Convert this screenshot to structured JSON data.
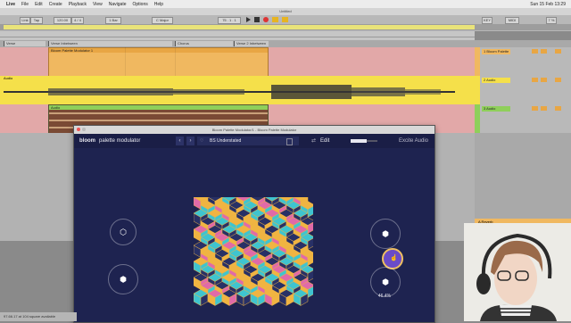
{
  "menubar": {
    "items": [
      "Live",
      "File",
      "Edit",
      "Create",
      "Playback",
      "View",
      "Navigate",
      "Options",
      "Help"
    ],
    "clock": "Sun 15 Feb 13:29"
  },
  "transport": {
    "tempo": "120.00",
    "signature": "4 / 4",
    "quantize": "1 Bar",
    "key": "C Major",
    "position": "75 . 1 . 1",
    "window_title": "Untitled",
    "cpu": "7 %",
    "midi": "MIDI",
    "key_btn": "KEY"
  },
  "arrangement": {
    "locators": [
      "Verse",
      "Verse Inbetween",
      "Chorus",
      "Verse 2 Inbetween"
    ],
    "tracks": [
      {
        "name": "Bloom Palette Modulator 1",
        "color": "#f0b860"
      },
      {
        "name": "Audio",
        "color": "#f5e04a"
      },
      {
        "name": "Audio",
        "color": "#8fcf5a"
      }
    ],
    "bg_pink": "#e2a8a8"
  },
  "mixer": {
    "tracks": [
      {
        "name": "1 Bloom Palette",
        "color": "#f0b860"
      },
      {
        "name": "2 Audio",
        "color": "#f5e04a"
      },
      {
        "name": "3 Audio",
        "color": "#8fcf5a"
      }
    ],
    "returns": [
      "A Reverb",
      "B Delay",
      "Main"
    ]
  },
  "plugin": {
    "window_title": "Bloom Palette Modulator/1 - Bloom Palette Modulator",
    "brand": "bloom",
    "product": "palette modulator",
    "preset": "BS Understated",
    "edit_label": "Edit",
    "excite_label": "Excite Audio",
    "value_readout": "46.4%",
    "macro_right_level": 0.464,
    "colors": {
      "bg": "#1e2350",
      "orange": "#f0b442",
      "teal": "#3fc4cf",
      "pink": "#e06aa8",
      "navy": "#283066",
      "accent": "#6a4cc8"
    }
  },
  "status_bar": {
    "text": "97.66.17 at 104 square available"
  }
}
